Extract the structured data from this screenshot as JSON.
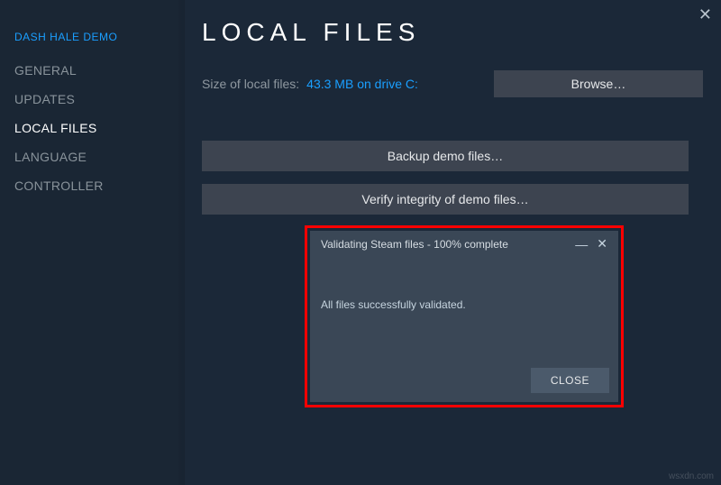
{
  "window": {
    "close_glyph": "✕"
  },
  "sidebar": {
    "crumb": "DASH HALE DEMO",
    "items": [
      {
        "label": "GENERAL"
      },
      {
        "label": "UPDATES"
      },
      {
        "label": "LOCAL FILES"
      },
      {
        "label": "LANGUAGE"
      },
      {
        "label": "CONTROLLER"
      }
    ],
    "active_index": 2
  },
  "main": {
    "title": "LOCAL FILES",
    "size_label": "Size of local files:",
    "size_value": "43.3 MB on drive C:",
    "browse_label": "Browse…",
    "backup_label": "Backup demo files…",
    "verify_label": "Verify integrity of demo files…"
  },
  "dialog": {
    "title": "Validating Steam files - 100% complete",
    "body": "All files successfully validated.",
    "min_glyph": "—",
    "close_glyph": "✕",
    "close_label": "CLOSE"
  },
  "watermark": "wsxdn.com"
}
